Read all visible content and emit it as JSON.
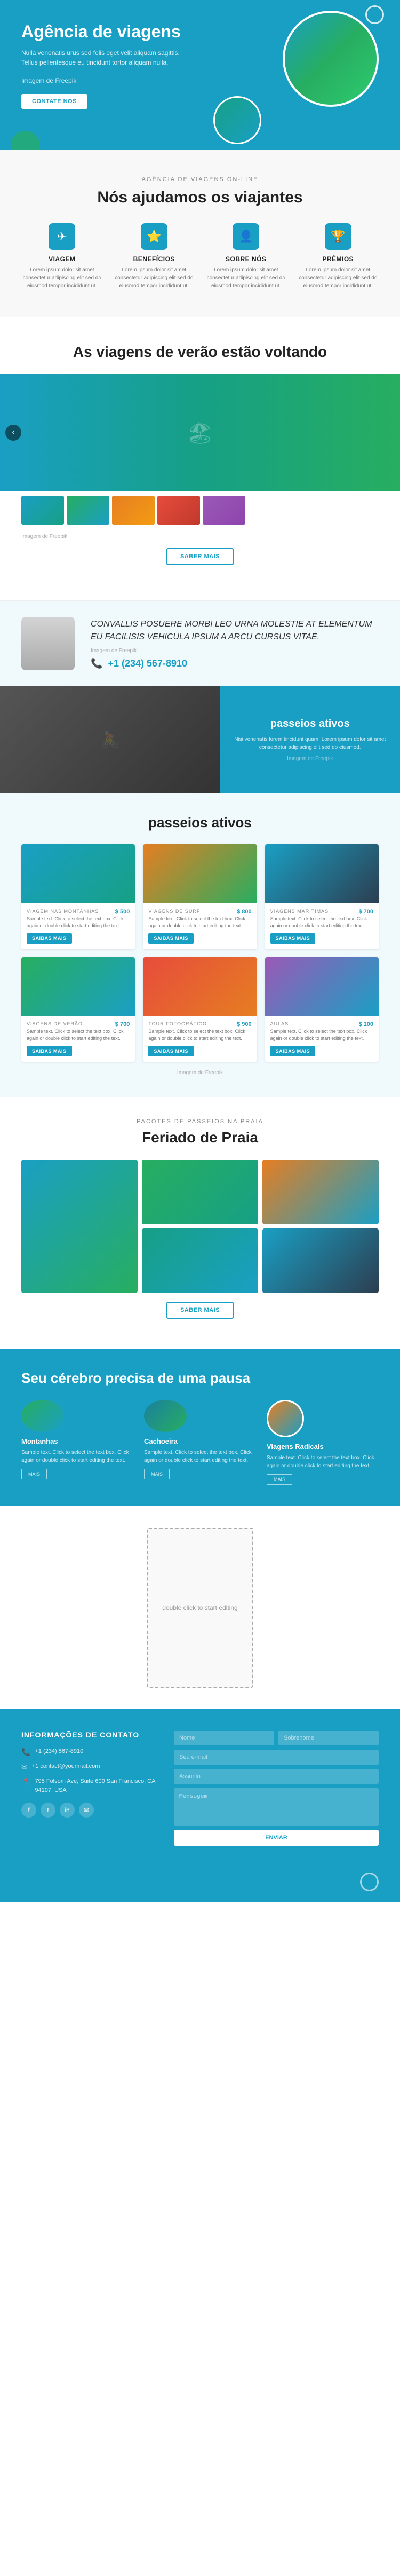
{
  "hero": {
    "title": "Agência de viagens",
    "description": "Nulla venenatis urus sed felis eget velit aliquam sagittis. Tellus pellentesque eu tincidunt tortor aliquam nulla.",
    "source_label": "Imagem de Freepik",
    "contact_button": "CONTATE NOS"
  },
  "agency": {
    "subtitle": "AGÊNCIA DE VIAGENS ON-LINE",
    "title": "Nós ajudamos os viajantes",
    "features": [
      {
        "icon": "✈",
        "title": "VIAGEM",
        "description": "Lorem ipsum dolor sit amet consectetur adipiscing elit sed do eiusmod tempor incididunt ut."
      },
      {
        "icon": "⭐",
        "title": "BENEFÍCIOS",
        "description": "Lorem ipsum dolor sit amet consectetur adipiscing elit sed do eiusmod tempor incididunt ut."
      },
      {
        "icon": "👤",
        "title": "SOBRE NÓS",
        "description": "Lorem ipsum dolor sit amet consectetur adipiscing elit sed do eiusmod tempor incididunt ut."
      },
      {
        "icon": "🏆",
        "title": "PRÊMIOS",
        "description": "Lorem ipsum dolor sit amet consectetur adipiscing elit sed do eiusmod tempor incididunt ut."
      }
    ]
  },
  "summer": {
    "title": "As viagens de verão estão voltando",
    "source_label": "Imagem de Freepik",
    "more_button": "SABER MAIS"
  },
  "contact_strip": {
    "quote": "CONVALLIS POSUERE MORBI LEO URNA MOLESTIE AT ELEMENTUM EU FACILISIS VEHICULA IPSUM A ARCU CURSUS VITAE.",
    "source_label": "Imagem de Freepik",
    "phone": "+1 (234) 567-8910"
  },
  "active_banner": {
    "title": "passeios ativos",
    "description": "Nisi venenatis lorem tincidunt quam. Lorem ipsum dolor sit amet consectetur adipiscing elit sed do eiusmod.",
    "source_label": "Imagem de Freepik"
  },
  "active_tours": {
    "title": "passeios ativos",
    "tours": [
      {
        "category": "VIAGEM NAS MONTANHAS",
        "price": "$ 500",
        "description": "Sample text. Click to select the text box. Click again or double click to start editing the text.",
        "button": "SAIBAS MAIS"
      },
      {
        "category": "VIAGENS DE SURF",
        "price": "$ 800",
        "description": "Sample text. Click to select the text box. Click again or double click to start editing the text.",
        "button": "SAIBAS MAIS"
      },
      {
        "category": "VIAGENS MARÍTIMAS",
        "price": "$ 700",
        "description": "Sample text. Click to select the text box. Click again or double click to start editing the text.",
        "button": "SAIBAS MAIS"
      },
      {
        "category": "VIAGENS DE VERÃO",
        "price": "$ 700",
        "description": "Sample text. Click to select the text box. Click again or double click to start editing the text.",
        "button": "SAIBAS MAIS"
      },
      {
        "category": "TOUR FOTOGRÁFICO",
        "price": "$ 900",
        "description": "Sample text. Click to select the text box. Click again or double click to start editing the text.",
        "button": "SAIBAS MAIS"
      },
      {
        "category": "AULAS",
        "price": "$ 100",
        "description": "Sample text. Click to select the text box. Click again or double click to start editing the text.",
        "button": "SAIBAS MAIS"
      }
    ],
    "source_label": "Imagem de Freepik"
  },
  "beach": {
    "subtitle": "PACOTES DE PASSEIOS NA PRAIA",
    "title": "Feriado de Praia",
    "more_button": "SABER MAIS"
  },
  "brain": {
    "title": "Seu cérebro precisa de uma pausa",
    "cards": [
      {
        "title": "Montanhas",
        "description": "Sample text. Click to select the text box. Click again or double click to start editing the text.",
        "button": "MAIS"
      },
      {
        "title": "Cachoeira",
        "description": "Sample text. Click to select the text box. Click again or double click to start editing the text.",
        "button": "MAIS"
      },
      {
        "title": "Viagens Radicais",
        "description": "Sample text. Click to select the text box. Click again or double click to start editing the text.",
        "button": "MAIS"
      }
    ]
  },
  "contact_footer": {
    "title": "informações de contato",
    "phone": "+1 (234) 567-8910",
    "email": "+1 contact@yourmail.com",
    "address": "795 Folsom Ave, Suite 600 San Francisco, CA 94107, USA",
    "form": {
      "first_name_placeholder": "Nome",
      "last_name_placeholder": "Sobrenome",
      "email_placeholder": "Seu e-mail",
      "subject_placeholder": "Assunto",
      "message_placeholder": "Mensagem",
      "send_button": "ENVIAR"
    },
    "social": [
      "f",
      "t",
      "in",
      "✉"
    ]
  },
  "edit_placeholder": {
    "text": "double click to start editing"
  }
}
